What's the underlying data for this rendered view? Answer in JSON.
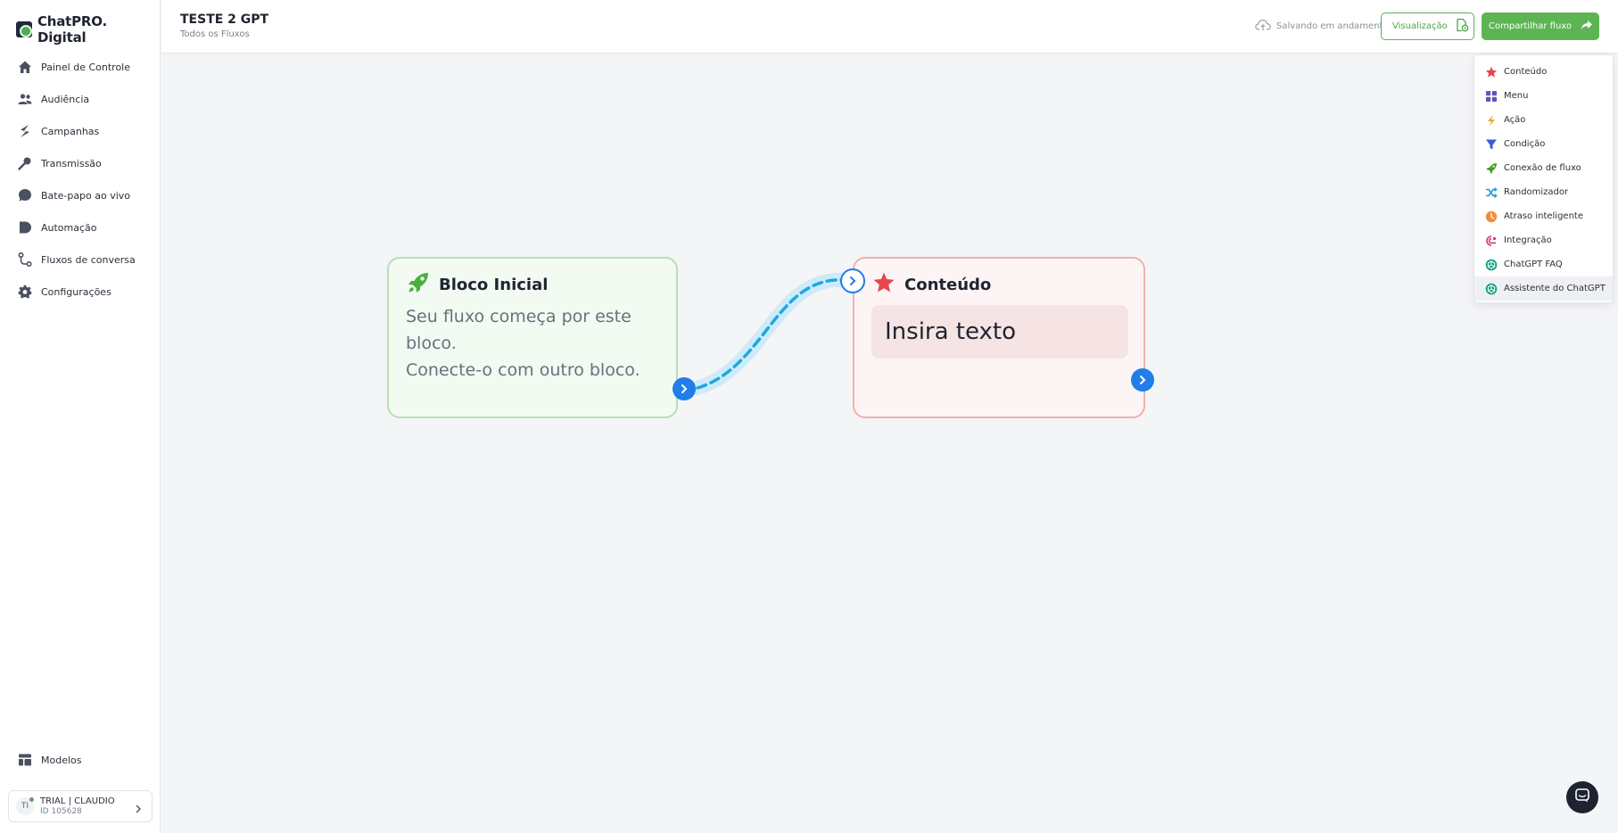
{
  "brand": {
    "name": "ChatPRO. Digital"
  },
  "sidebar": {
    "items": [
      {
        "label": "Painel de Controle",
        "icon": "home-icon"
      },
      {
        "label": "Audiência",
        "icon": "users-icon"
      },
      {
        "label": "Campanhas",
        "icon": "bolt-icon"
      },
      {
        "label": "Transmissão",
        "icon": "broadcast-icon"
      },
      {
        "label": "Bate-papo ao vivo",
        "icon": "chat-icon"
      },
      {
        "label": "Automação",
        "icon": "play-icon"
      },
      {
        "label": "Fluxos de conversa",
        "icon": "flow-icon"
      },
      {
        "label": "Configurações",
        "icon": "gear-icon"
      }
    ],
    "models_label": "Modelos",
    "user": {
      "initials": "TI",
      "name": "TRIAL | CLAUDIO",
      "id": "ID 105628"
    }
  },
  "header": {
    "title": "TESTE 2 GPT",
    "breadcrumb": "Todos os Fluxos",
    "saving_status": "Salvando em andamento",
    "preview_label": "Visualização",
    "share_label": "Compartilhar fluxo"
  },
  "canvas": {
    "start_block": {
      "title": "Bloco Inicial",
      "description_line1": "Seu fluxo começa por este bloco.",
      "description_line2": "Conecte-o com outro bloco."
    },
    "content_block": {
      "title": "Conteúdo",
      "placeholder": "Insira texto"
    }
  },
  "dropdown": {
    "items": [
      {
        "label": "Conteúdo",
        "icon": "star-icon",
        "color": "#e5484d"
      },
      {
        "label": "Menu",
        "icon": "grid-icon",
        "color": "#6b4fbb"
      },
      {
        "label": "Ação",
        "icon": "lightning-icon",
        "color": "#f5a623"
      },
      {
        "label": "Condição",
        "icon": "funnel-icon",
        "color": "#3b5bdb"
      },
      {
        "label": "Conexão de fluxo",
        "icon": "rocket-icon",
        "color": "#40a02b"
      },
      {
        "label": "Randomizador",
        "icon": "shuffle-icon",
        "color": "#1c9bd6"
      },
      {
        "label": "Atraso inteligente",
        "icon": "clock-icon",
        "color": "#f08c3b"
      },
      {
        "label": "Integração",
        "icon": "webhook-icon",
        "color": "#d63384"
      },
      {
        "label": "ChatGPT FAQ",
        "icon": "openai-icon",
        "color": "#10a37f"
      },
      {
        "label": "Assistente do ChatGPT",
        "icon": "openai-icon",
        "color": "#10a37f"
      }
    ],
    "active_index": 9
  },
  "colors": {
    "accent_green": "#5cb552",
    "port_blue": "#1f7ee8",
    "wire_blue": "#1ea7e4"
  }
}
